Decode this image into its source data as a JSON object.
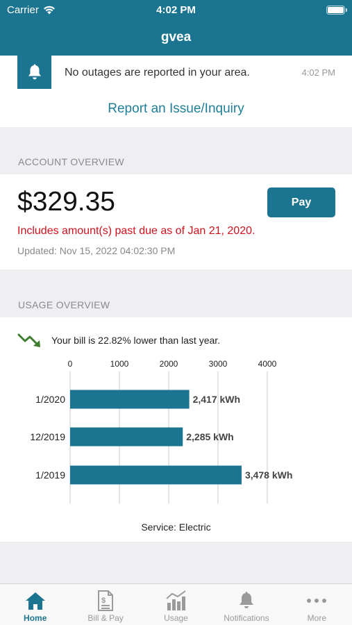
{
  "status_bar": {
    "carrier": "Carrier",
    "time": "4:02 PM"
  },
  "app": {
    "title": "gvea",
    "accent_color": "#1c7590"
  },
  "outage": {
    "icon": "bell-icon",
    "message": "No outages are reported in your area.",
    "time": "4:02 PM",
    "report_link": "Report an Issue/Inquiry"
  },
  "account_overview": {
    "section_label": "ACCOUNT OVERVIEW",
    "amount": "$329.35",
    "pay_label": "Pay",
    "past_due": "Includes amount(s) past due as of Jan 21, 2020.",
    "updated": "Updated: Nov 15, 2022 04:02:30 PM",
    "past_due_color": "#d0111b"
  },
  "usage_overview": {
    "section_label": "USAGE OVERVIEW",
    "trend_icon": "trending-down-icon",
    "trend_text": "Your bill is 22.82% lower than last year.",
    "service_label": "Service: Electric"
  },
  "chart_data": {
    "type": "bar",
    "orientation": "horizontal",
    "categories": [
      "1/2020",
      "12/2019",
      "1/2019"
    ],
    "values": [
      2417,
      2285,
      3478
    ],
    "value_labels": [
      "2,417 kWh",
      "2,285 kWh",
      "3,478 kWh"
    ],
    "x_ticks": [
      "0",
      "1000",
      "2000",
      "3000",
      "4000"
    ],
    "xlim": [
      0,
      4000
    ],
    "grid": true,
    "bar_color": "#1c7590"
  },
  "tab_bar": {
    "tabs": [
      {
        "label": "Home",
        "icon": "home-icon",
        "active": true
      },
      {
        "label": "Bill & Pay",
        "icon": "bill-icon",
        "active": false
      },
      {
        "label": "Usage",
        "icon": "usage-chart-icon",
        "active": false
      },
      {
        "label": "Notifications",
        "icon": "bell-icon",
        "active": false
      },
      {
        "label": "More",
        "icon": "more-dots-icon",
        "active": false
      }
    ]
  }
}
